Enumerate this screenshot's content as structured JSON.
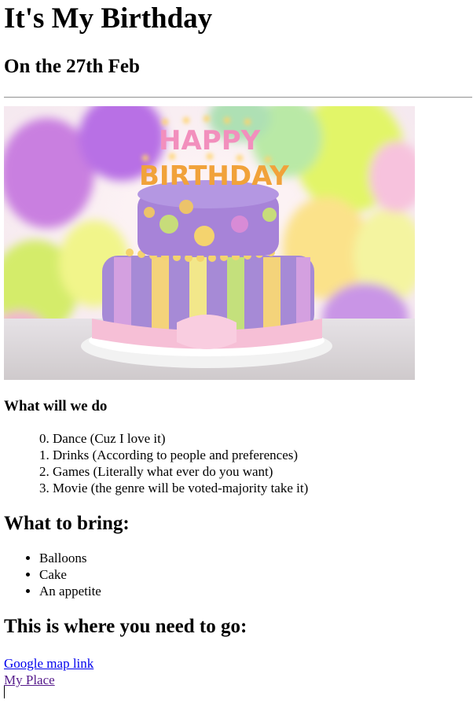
{
  "header": {
    "title": "It's My Birthday",
    "subtitle": "On the 27th Feb"
  },
  "image": {
    "cake_text_top": "HAPPY",
    "cake_text_bottom": "BIRTHDAY"
  },
  "activities": {
    "heading": "What will we do",
    "items": [
      {
        "number": "0.",
        "label": "Dance (Cuz I love it)"
      },
      {
        "number": "1.",
        "label": "Drinks (According to people and preferences)"
      },
      {
        "number": "2.",
        "label": "Games (Literally what ever do you want)"
      },
      {
        "number": "3.",
        "label": "Movie (the genre will be voted-majority take it)"
      }
    ]
  },
  "bring": {
    "heading": "What to bring:",
    "items": [
      "Balloons",
      "Cake",
      "An appetite"
    ]
  },
  "location": {
    "heading": "This is where you need to go:",
    "map_link": "Google map link",
    "place_link": "My Place"
  },
  "colors": {
    "link": "#0000ee",
    "visited_link": "#551a8b",
    "rule": "#9a9a9a"
  }
}
